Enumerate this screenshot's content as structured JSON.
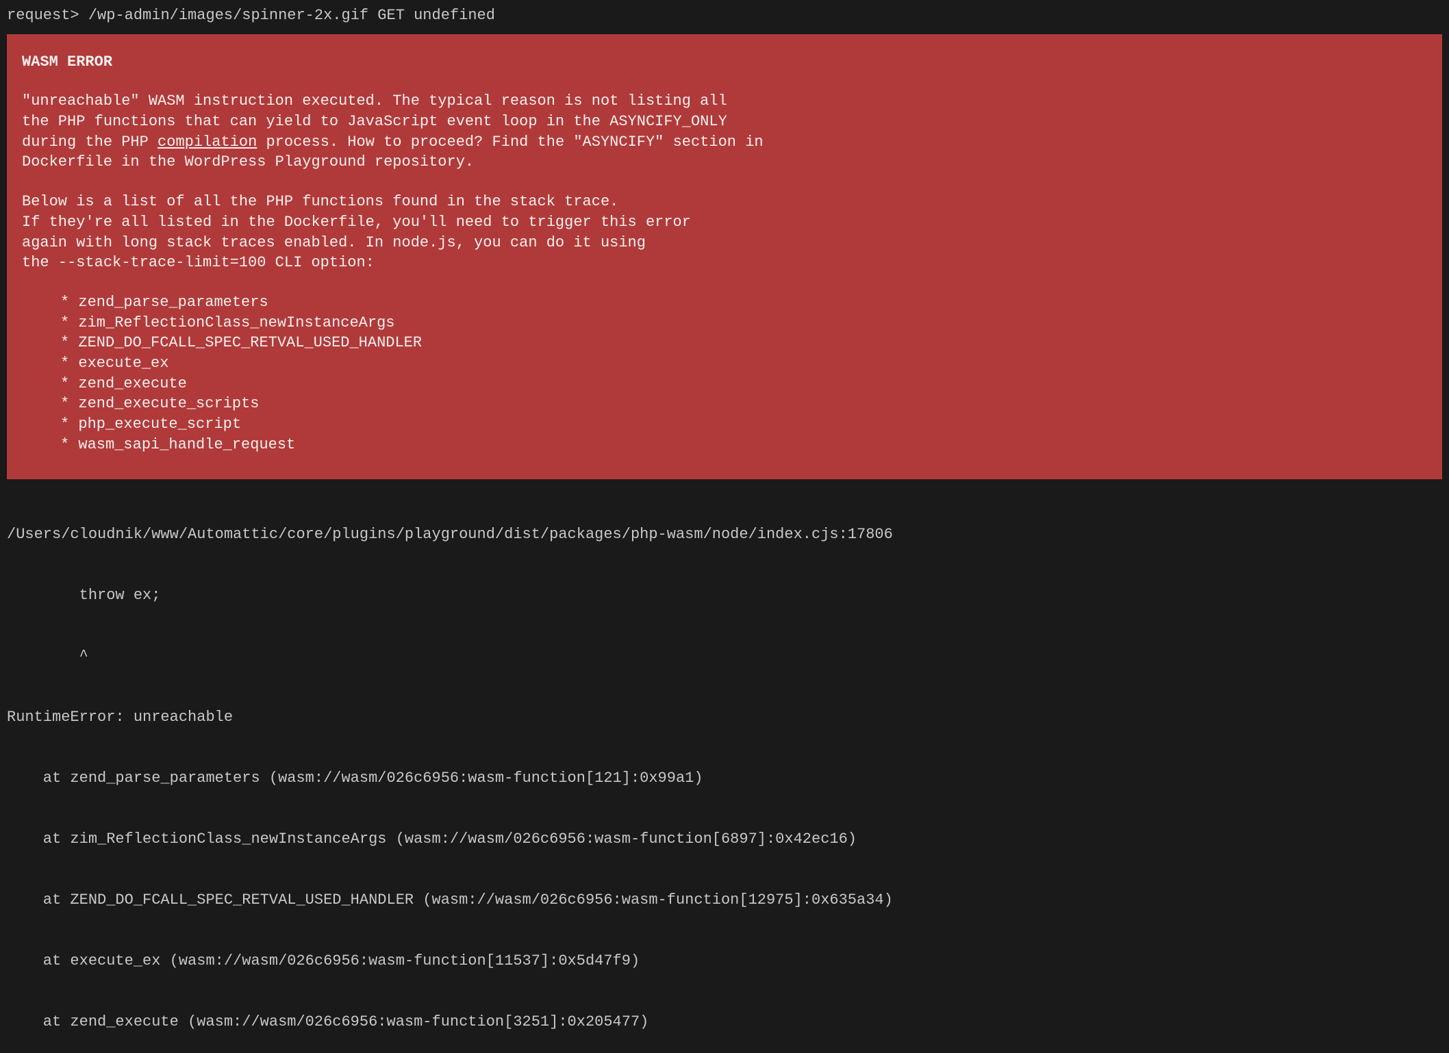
{
  "request": {
    "prefix": "request> ",
    "path": "/wp-admin/images/spinner-2x.gif GET undefined"
  },
  "error": {
    "title": "WASM ERROR",
    "para1_a": "\"unreachable\" WASM instruction executed. The typical reason is not listing all\nthe PHP functions that can yield to JavaScript event loop in the ASYNCIFY_ONLY\nduring the PHP ",
    "para1_link": "compilation",
    "para1_b": " process. How to proceed? Find the \"ASYNCIFY\" section in\nDockerfile in the WordPress Playground repository.",
    "para2": "Below is a list of all the PHP functions found in the stack trace.\nIf they're all listed in the Dockerfile, you'll need to trigger this error\nagain with long stack traces enabled. In node.js, you can do it using\nthe --stack-trace-limit=100 CLI option:",
    "functions": [
      "zend_parse_parameters",
      "zim_ReflectionClass_newInstanceArgs",
      "ZEND_DO_FCALL_SPEC_RETVAL_USED_HANDLER",
      "execute_ex",
      "zend_execute",
      "zend_execute_scripts",
      "php_execute_script",
      "wasm_sapi_handle_request"
    ]
  },
  "stack": {
    "file_line": "/Users/cloudnik/www/Automattic/core/plugins/playground/dist/packages/php-wasm/node/index.cjs:17806",
    "throw_line": "        throw ex;",
    "caret_line": "        ^",
    "runtime_error": "RuntimeError: unreachable",
    "frames": [
      "    at zend_parse_parameters (wasm://wasm/026c6956:wasm-function[121]:0x99a1)",
      "    at zim_ReflectionClass_newInstanceArgs (wasm://wasm/026c6956:wasm-function[6897]:0x42ec16)",
      "    at ZEND_DO_FCALL_SPEC_RETVAL_USED_HANDLER (wasm://wasm/026c6956:wasm-function[12975]:0x635a34)",
      "    at execute_ex (wasm://wasm/026c6956:wasm-function[11537]:0x5d47f9)",
      "    at zend_execute (wasm://wasm/026c6956:wasm-function[3251]:0x205477)"
    ]
  }
}
